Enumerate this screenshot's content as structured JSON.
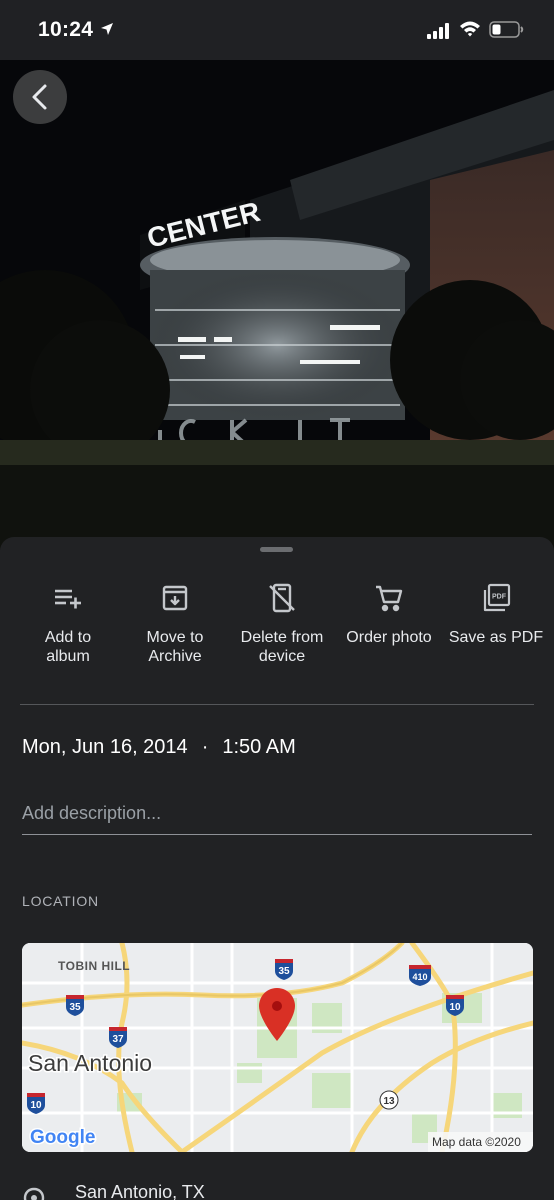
{
  "status_bar": {
    "time": "10:24"
  },
  "actions": [
    {
      "label": "Add to album",
      "icon": "playlist-add-icon"
    },
    {
      "label": "Move to Archive",
      "icon": "archive-icon"
    },
    {
      "label": "Delete from device",
      "icon": "delete-from-device-icon"
    },
    {
      "label": "Order photo",
      "icon": "cart-icon"
    },
    {
      "label": "Save as PDF",
      "icon": "pdf-icon"
    }
  ],
  "info": {
    "date": "Mon, Jun 16, 2014",
    "time": "1:50 AM",
    "description_placeholder": "Add description..."
  },
  "location": {
    "header": "LOCATION",
    "place": "San Antonio, TX",
    "map": {
      "city_label": "San Antonio",
      "neighborhood_label": "TOBIN HILL",
      "attribution": "Map data ©2020",
      "logo": "Google",
      "shields": [
        "35",
        "35",
        "37",
        "10",
        "410",
        "10",
        "35",
        "13"
      ]
    }
  },
  "photo": {
    "sign_text": "CENTER"
  }
}
